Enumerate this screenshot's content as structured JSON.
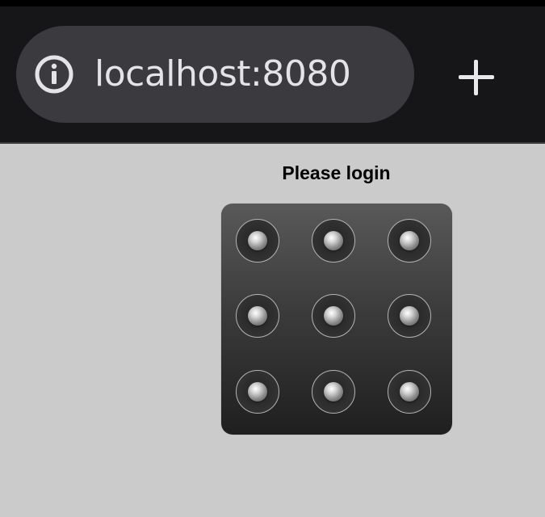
{
  "browser": {
    "url": "localhost:8080",
    "info_icon": "info-icon",
    "new_tab_icon": "plus-icon"
  },
  "page": {
    "title": "Please login"
  },
  "pattern_lock": {
    "rows": 3,
    "cols": 3,
    "dots": [
      1,
      2,
      3,
      4,
      5,
      6,
      7,
      8,
      9
    ]
  },
  "colors": {
    "page_background": "#cbcbcb",
    "browser_bar": "#161618",
    "address_pill": "#3a3a3f",
    "pad_top": "#595959",
    "pad_bottom": "#1f1f1f"
  }
}
